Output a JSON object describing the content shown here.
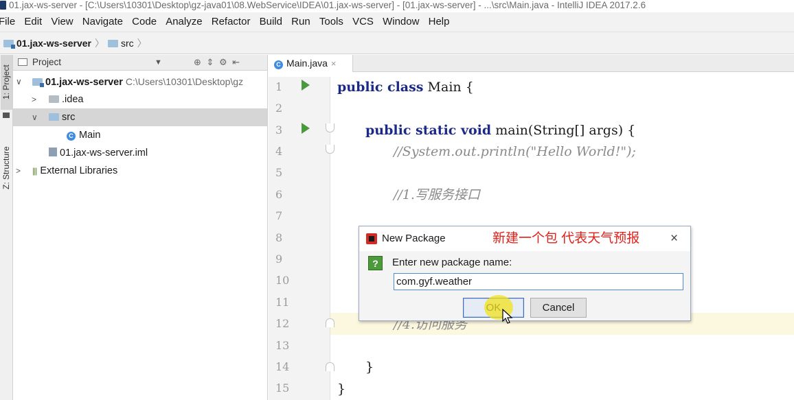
{
  "window": {
    "title": "01.jax-ws-server - [C:\\Users\\10301\\Desktop\\gz-java01\\08.WebService\\IDEA\\01.jax-ws-server] - [01.jax-ws-server] - ...\\src\\Main.java - IntelliJ IDEA 2017.2.6"
  },
  "menu": {
    "items": [
      "File",
      "Edit",
      "View",
      "Navigate",
      "Code",
      "Analyze",
      "Refactor",
      "Build",
      "Run",
      "Tools",
      "VCS",
      "Window",
      "Help"
    ]
  },
  "breadcrumb": {
    "project": "01.jax-ws-server",
    "folder": "src"
  },
  "sidebar_tabs": {
    "project": "1: Project",
    "structure": "Z: Structure"
  },
  "project_panel": {
    "title": "Project",
    "tools": "⊕ ⇕ ⚙ ⇤",
    "root_name": "01.jax-ws-server",
    "root_path": "C:\\Users\\10301\\Desktop\\gz",
    "idea": ".idea",
    "src": "src",
    "main": "Main",
    "iml": "01.jax-ws-server.iml",
    "libs": "External Libraries"
  },
  "editor": {
    "tab": "Main.java",
    "line_numbers": [
      "1",
      "2",
      "3",
      "4",
      "5",
      "6",
      "7",
      "8",
      "9",
      "10",
      "11",
      "12",
      "13",
      "14",
      "15"
    ],
    "code": {
      "l1_kw": "public class",
      "l1_rest": " Main {",
      "l3_kw": "public static void",
      "l3_rest": " main(String[] args) {",
      "l4": "//System.out.println(\"Hello World!\");",
      "l6": "//1.写服务接口",
      "l12": "//4.访问服务",
      "l14": "}",
      "l15": "}"
    }
  },
  "dialog": {
    "title": "New Package",
    "annotation": "新建一个包 代表天气预报",
    "prompt": "Enter new package name:",
    "input_value": "com.gyf.weather",
    "ok": "OK",
    "cancel": "Cancel",
    "close": "×"
  },
  "colors": {
    "keyword": "#1b2a87",
    "comment": "#8a8a8a",
    "annotation": "#e0201a",
    "run_icon": "#4a9a3d"
  }
}
